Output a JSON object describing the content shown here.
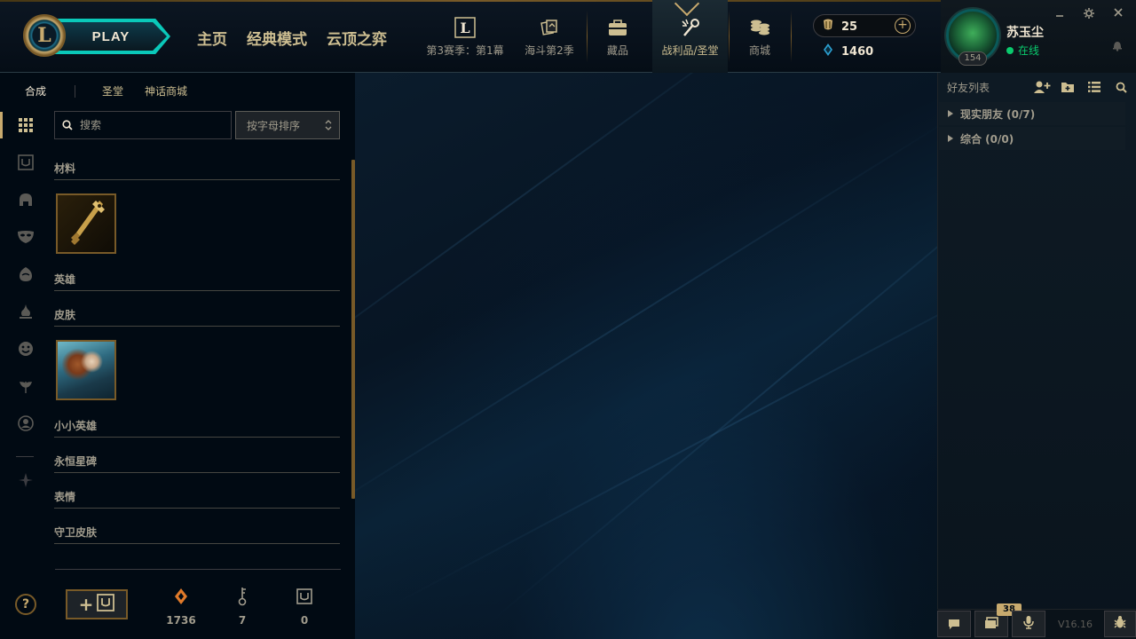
{
  "header": {
    "logo_letter": "L",
    "play_label": "PLAY",
    "main_nav": [
      "主页",
      "经典模式",
      "云顶之弈"
    ],
    "sub_nav": [
      {
        "label": "第3赛季：第1幕",
        "icon": "season-l-icon"
      },
      {
        "label": "海斗第2季",
        "icon": "battlepass-icon"
      },
      {
        "label": "藏品",
        "icon": "collection-icon"
      },
      {
        "label": "战利品/圣堂",
        "icon": "loot-icon",
        "active": true
      },
      {
        "label": "商城",
        "icon": "store-icon"
      }
    ],
    "currency": {
      "rp": "25",
      "be": "1460"
    },
    "profile": {
      "username": "苏玉尘",
      "status": "在线",
      "level": "154"
    }
  },
  "loot": {
    "tabs": {
      "craft": "合成",
      "sanctum": "圣堂",
      "mythic_shop": "神话商城"
    },
    "search_placeholder": "搜索",
    "sort_label": "按字母排序",
    "categories": {
      "materials": "材料",
      "champions": "英雄",
      "skins": "皮肤",
      "little_legends": "小小英雄",
      "eternals": "永恒星碑",
      "emotes": "表情",
      "ward_skins": "守卫皮肤"
    },
    "counters": {
      "orange_essence": "1736",
      "keys": "7",
      "chests": "0"
    },
    "add_chest_plus": "+"
  },
  "friends": {
    "title": "好友列表",
    "groups": [
      {
        "label": "现实朋友 (0/7)"
      },
      {
        "label": "综合 (0/0)"
      }
    ],
    "notification_count": "38",
    "version": "V16.16",
    "help_label": "?"
  },
  "colors": {
    "gold": "#c8aa6e",
    "dark_gold": "#785a28",
    "teal": "#0ac8b9",
    "bg": "#010a13",
    "online": "#0acb6e"
  }
}
